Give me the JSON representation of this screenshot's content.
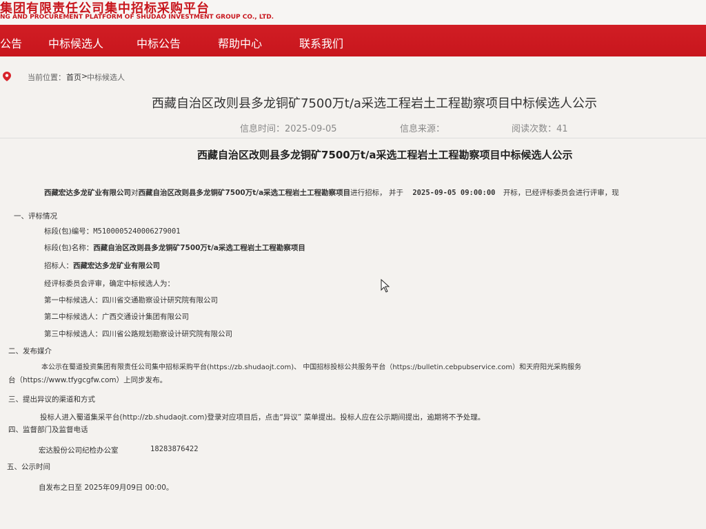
{
  "header": {
    "logo_cn": "集团有限责任公司集中招标采购平台",
    "logo_en": "NG AND PROCUREMENT PLATFORM OF SHUDAO INVESTMENT GROUP CO., LTD.",
    "nav": [
      "公告",
      "中标候选人",
      "中标公告",
      "帮助中心",
      "联系我们"
    ]
  },
  "breadcrumb": {
    "label": "当前位置：",
    "home": "首页",
    "sep": ">",
    "current": "中标候选人"
  },
  "title": "西藏自治区改则县多龙铜矿7500万t/a采选工程岩土工程勘察项目中标候选人公示",
  "meta": {
    "time": "信息时间：2025-09-05",
    "source": "信息来源：",
    "reads": "阅读次数：41"
  },
  "doc": {
    "title": "西藏自治区改则县多龙铜矿7500万t/a采选工程岩土工程勘察项目中标候选人公示",
    "intro": {
      "company": "西藏宏达多龙矿业有限公司",
      "dui": "对",
      "project": "西藏自治区改则县多龙铜矿7500万t/a采选工程岩土工程勘察项目",
      "tail1": "进行招标， 并于",
      "datetime": "2025-09-05  09:00:00",
      "tail2": "开标，已经评标委员会进行评审，现"
    },
    "s1": {
      "heading": "一、评标情况",
      "code_label": "标段(包)编号：",
      "code": "M5100005240006279001",
      "name_label": "标段(包)名称：",
      "name": "西藏自治区改则县多龙铜矿7500万t/a采选工程岩土工程勘察项目",
      "tenderer_label": "招标人：",
      "tenderer": "西藏宏达多龙矿业有限公司",
      "review": "经评标委员会评审，确定中标候选人为：",
      "c1": "第一中标候选人：四川省交通勘察设计研究院有限公司",
      "c2": "第二中标候选人：广西交通设计集团有限公司",
      "c3": "第三中标候选人：四川省公路规划勘察设计研究院有限公司"
    },
    "s2": {
      "heading": "二、发布媒介",
      "text1": "本公示在蜀道投资集团有限责任公司集中招标采购平台(https://zb.shudaojt.com)、  中国招标投标公共服务平台（https://bulletin.cebpubservice.com）和天府阳光采购服务",
      "text2": "台（https://www.tfygcgfw.com）上同步发布。"
    },
    "s3": {
      "heading": "三、提出异议的渠道和方式",
      "text": "投标人进入蜀道集采平台(http://zb.shudaojt.com)登录对应项目后，点击“异议”  菜单提出。投标人应在公示期间提出，逾期将不予处理。"
    },
    "s4": {
      "heading": "四、监督部门及监督电话",
      "dept": "宏达股份公司纪检办公室",
      "phone": "18283876422"
    },
    "s5": {
      "heading": "五、公示时间",
      "text": "自发布之日至  2025年09月09日  00:00。"
    }
  },
  "colors": {
    "brand_red": "#c8161d",
    "bg": "#f4f2ef"
  },
  "icons": [
    "location-pin-icon",
    "mouse-cursor-icon"
  ]
}
